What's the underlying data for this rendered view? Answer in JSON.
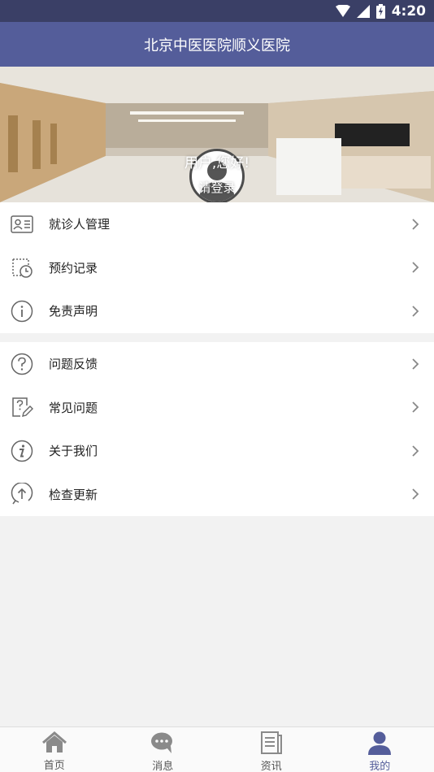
{
  "status_bar": {
    "time": "4:20"
  },
  "header": {
    "title": "北京中医医院顺义医院"
  },
  "profile": {
    "greeting": "用户,您好!",
    "login_link": "请登录"
  },
  "menu_group_1": [
    {
      "label": "就诊人管理",
      "icon": "patient-card-icon"
    },
    {
      "label": "预约记录",
      "icon": "calendar-clock-icon"
    },
    {
      "label": "免责声明",
      "icon": "info-circle-icon"
    }
  ],
  "menu_group_2": [
    {
      "label": "问题反馈",
      "icon": "question-circle-icon"
    },
    {
      "label": "常见问题",
      "icon": "question-edit-icon"
    },
    {
      "label": "关于我们",
      "icon": "info-italic-icon"
    },
    {
      "label": "检查更新",
      "icon": "upload-circle-icon"
    }
  ],
  "bottom_nav": [
    {
      "label": "首页",
      "icon": "home-icon"
    },
    {
      "label": "消息",
      "icon": "chat-icon"
    },
    {
      "label": "资讯",
      "icon": "news-icon"
    },
    {
      "label": "我的",
      "icon": "person-icon",
      "active": true
    }
  ],
  "colors": {
    "header": "#545d9a",
    "status_bar": "#3a3f66",
    "active_tab": "#545d9a"
  }
}
